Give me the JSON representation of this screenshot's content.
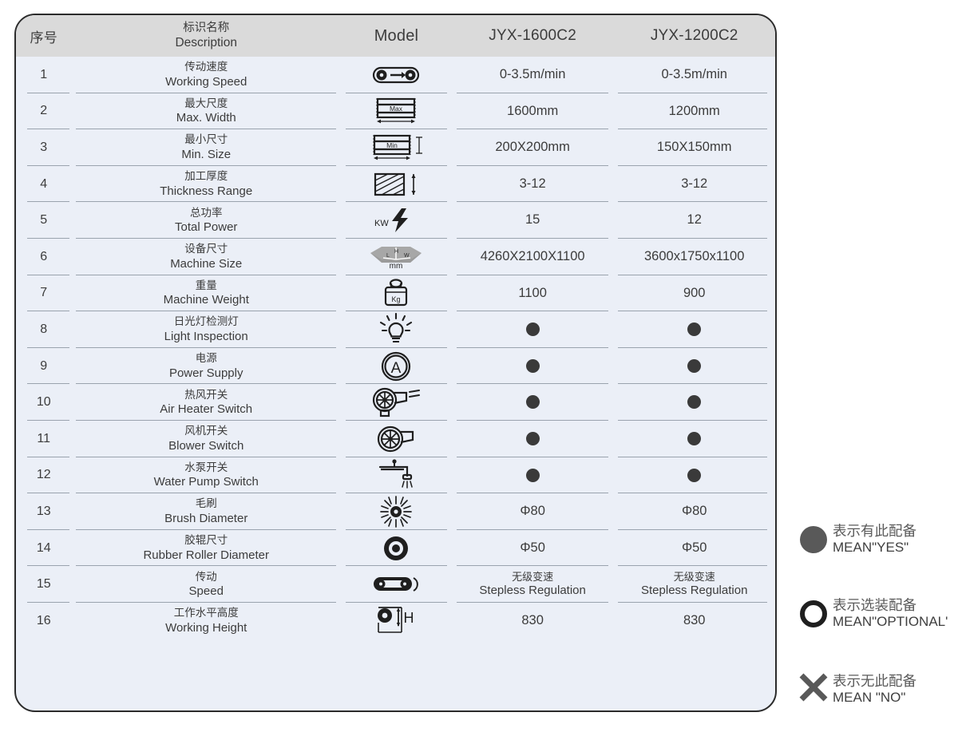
{
  "table": {
    "header": {
      "index": "序号",
      "description_cn": "标识名称",
      "description_en": "Description",
      "model": "Model",
      "col4": "JYX-1600C2",
      "col5": "JYX-1200C2"
    },
    "rows": [
      {
        "no": "1",
        "cn": "传动速度",
        "en": "Working Speed",
        "icon": "belt-drive-arrow-icon",
        "v1": "0-3.5m/min",
        "v2": "0-3.5m/min",
        "type": "text"
      },
      {
        "no": "2",
        "cn": "最大尺度",
        "en": "Max. Width",
        "icon": "max-width-icon",
        "icon_label": "Max",
        "v1": "1600mm",
        "v2": "1200mm",
        "type": "text"
      },
      {
        "no": "3",
        "cn": "最小尺寸",
        "en": "Min. Size",
        "icon": "min-size-icon",
        "icon_label": "Min",
        "v1": "200X200mm",
        "v2": "150X150mm",
        "type": "text"
      },
      {
        "no": "4",
        "cn": "加工厚度",
        "en": "Thickness Range",
        "icon": "thickness-range-icon",
        "v1": "3-12",
        "v2": "3-12",
        "type": "text"
      },
      {
        "no": "5",
        "cn": "总功率",
        "en": "Total Power",
        "icon": "power-bolt-kw-icon",
        "icon_label": "KW",
        "v1": "15",
        "v2": "12",
        "type": "text"
      },
      {
        "no": "6",
        "cn": "设备尺寸",
        "en": "Machine Size",
        "icon": "machine-dimensions-icon",
        "icon_label": "mm",
        "v1": "4260X2100X1100",
        "v2": "3600x1750x1100",
        "type": "text"
      },
      {
        "no": "7",
        "cn": "重量",
        "en": "Machine Weight",
        "icon": "weight-kg-icon",
        "icon_label": "Kg",
        "v1": "1100",
        "v2": "900",
        "type": "text"
      },
      {
        "no": "8",
        "cn": "日光灯检测灯",
        "en": "Light Inspection",
        "icon": "light-bulb-icon",
        "v1": "dot",
        "v2": "dot",
        "type": "mark"
      },
      {
        "no": "9",
        "cn": "电源",
        "en": "Power Supply",
        "icon": "ampere-circle-icon",
        "v1": "dot",
        "v2": "dot",
        "type": "mark"
      },
      {
        "no": "10",
        "cn": "热风开关",
        "en": "Air Heater Switch",
        "icon": "air-heater-blower-icon",
        "v1": "dot",
        "v2": "dot",
        "type": "mark"
      },
      {
        "no": "11",
        "cn": "风机开关",
        "en": "Blower Switch",
        "icon": "blower-fan-icon",
        "v1": "dot",
        "v2": "dot",
        "type": "mark"
      },
      {
        "no": "12",
        "cn": "水泵开关",
        "en": "Water Pump Switch",
        "icon": "water-tap-icon",
        "v1": "dot",
        "v2": "dot",
        "type": "mark"
      },
      {
        "no": "13",
        "cn": "毛刷",
        "en": "Brush Diameter",
        "icon": "brush-roller-icon",
        "v1": "Φ80",
        "v2": "Φ80",
        "type": "text"
      },
      {
        "no": "14",
        "cn": "胶辊尺寸",
        "en": "Rubber Roller Diameter",
        "icon": "rubber-roller-icon",
        "v1": "Φ50",
        "v2": "Φ50",
        "type": "text"
      },
      {
        "no": "15",
        "cn": "传动",
        "en": "Speed",
        "icon": "belt-drive-rotation-icon",
        "v1_cn": "无级变速",
        "v1_en": "Stepless Regulation",
        "v2_cn": "无级变速",
        "v2_en": "Stepless Regulation",
        "type": "bilingual"
      },
      {
        "no": "16",
        "cn": "工作水平高度",
        "en": "Working Height",
        "icon": "working-height-icon",
        "icon_label": "H",
        "v1": "830",
        "v2": "830",
        "type": "text"
      }
    ]
  },
  "legend": {
    "items": [
      {
        "mark": "filled-circle",
        "cn": "表示有此配备",
        "en": "MEAN\"YES\""
      },
      {
        "mark": "open-circle",
        "cn": "表示选装配备",
        "en": "MEAN\"OPTIONAL'"
      },
      {
        "mark": "cross",
        "cn": "表示无此配备",
        "en": "MEAN \"NO\""
      }
    ]
  },
  "colors": {
    "header_bg": "#dadada",
    "row_bg": "#ebeff7",
    "border": "#2b2b2b",
    "rule": "#9aa3ae",
    "dot": "#3a3a3a",
    "legend_mark": "#595959",
    "text": "#3c3c3c"
  }
}
